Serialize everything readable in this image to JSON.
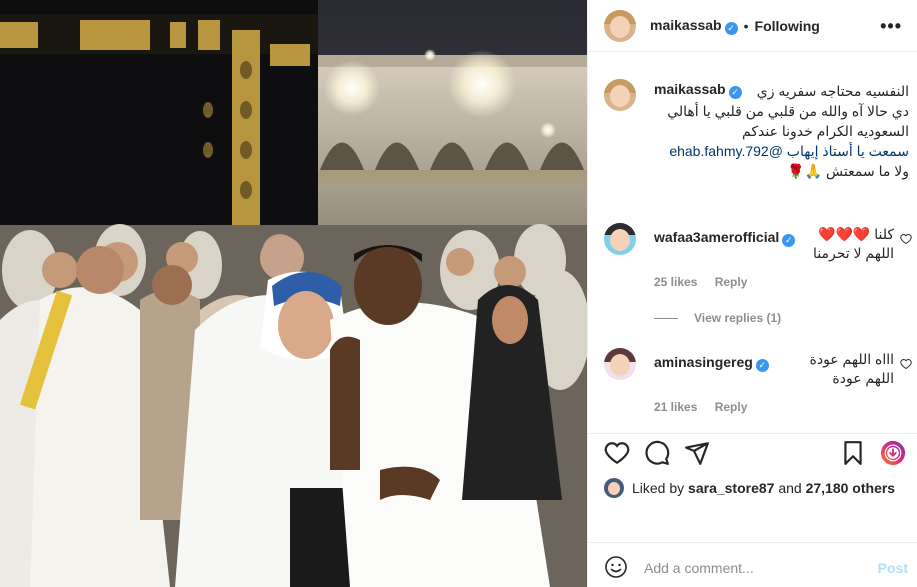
{
  "post": {
    "username": "maikassab",
    "verified_mark": "✓",
    "separator": "•",
    "follow_status": "Following",
    "more_icon": "more-horizontal-icon",
    "caption_lines": [
      "النفسيه محتاجه سفريه زي",
      "دي حالا آه والله من قلبي من قلبي يا أهالي",
      "السعوديه الكرام خدونا عندكم",
      "سمعت يا أستاذ إيهاب @ehab.fahmy.792",
      "ولا ما سمعتش 🙏🌹"
    ]
  },
  "comments": [
    {
      "username": "wafaa3amerofficial",
      "lines": [
        "كلنا ❤️❤️❤️",
        "اللهم لا تحرمنا"
      ],
      "likes": "25 likes",
      "reply_label": "Reply",
      "view_replies": "View replies (1)"
    },
    {
      "username": "aminasingereg",
      "lines": [
        "اااه اللهم عودة",
        "اللهم عودة"
      ],
      "likes": "21 likes",
      "reply_label": "Reply"
    }
  ],
  "liked_by": {
    "prefix": "Liked by",
    "user": "sara_store87",
    "middle": "and",
    "others": "27,180 others"
  },
  "add_comment": {
    "placeholder": "Add a comment...",
    "post_label": "Post"
  },
  "colors": {
    "verified": "#3897f0",
    "mention": "#00376b",
    "muted": "#8e8e8e",
    "post_disabled": "#b2dffc",
    "reels_gradient": [
      "#f58529",
      "#dd2a7b",
      "#8134af"
    ]
  },
  "icons": [
    "heart-icon",
    "comment-icon",
    "share-icon",
    "bookmark-icon",
    "reels-icon",
    "emoji-icon"
  ]
}
